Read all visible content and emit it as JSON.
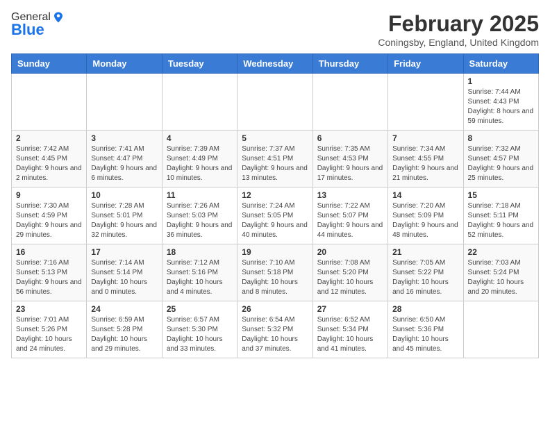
{
  "logo": {
    "general": "General",
    "blue": "Blue"
  },
  "header": {
    "month": "February 2025",
    "location": "Coningsby, England, United Kingdom"
  },
  "weekdays": [
    "Sunday",
    "Monday",
    "Tuesday",
    "Wednesday",
    "Thursday",
    "Friday",
    "Saturday"
  ],
  "weeks": [
    [
      {
        "day": "",
        "info": ""
      },
      {
        "day": "",
        "info": ""
      },
      {
        "day": "",
        "info": ""
      },
      {
        "day": "",
        "info": ""
      },
      {
        "day": "",
        "info": ""
      },
      {
        "day": "",
        "info": ""
      },
      {
        "day": "1",
        "info": "Sunrise: 7:44 AM\nSunset: 4:43 PM\nDaylight: 8 hours and 59 minutes."
      }
    ],
    [
      {
        "day": "2",
        "info": "Sunrise: 7:42 AM\nSunset: 4:45 PM\nDaylight: 9 hours and 2 minutes."
      },
      {
        "day": "3",
        "info": "Sunrise: 7:41 AM\nSunset: 4:47 PM\nDaylight: 9 hours and 6 minutes."
      },
      {
        "day": "4",
        "info": "Sunrise: 7:39 AM\nSunset: 4:49 PM\nDaylight: 9 hours and 10 minutes."
      },
      {
        "day": "5",
        "info": "Sunrise: 7:37 AM\nSunset: 4:51 PM\nDaylight: 9 hours and 13 minutes."
      },
      {
        "day": "6",
        "info": "Sunrise: 7:35 AM\nSunset: 4:53 PM\nDaylight: 9 hours and 17 minutes."
      },
      {
        "day": "7",
        "info": "Sunrise: 7:34 AM\nSunset: 4:55 PM\nDaylight: 9 hours and 21 minutes."
      },
      {
        "day": "8",
        "info": "Sunrise: 7:32 AM\nSunset: 4:57 PM\nDaylight: 9 hours and 25 minutes."
      }
    ],
    [
      {
        "day": "9",
        "info": "Sunrise: 7:30 AM\nSunset: 4:59 PM\nDaylight: 9 hours and 29 minutes."
      },
      {
        "day": "10",
        "info": "Sunrise: 7:28 AM\nSunset: 5:01 PM\nDaylight: 9 hours and 32 minutes."
      },
      {
        "day": "11",
        "info": "Sunrise: 7:26 AM\nSunset: 5:03 PM\nDaylight: 9 hours and 36 minutes."
      },
      {
        "day": "12",
        "info": "Sunrise: 7:24 AM\nSunset: 5:05 PM\nDaylight: 9 hours and 40 minutes."
      },
      {
        "day": "13",
        "info": "Sunrise: 7:22 AM\nSunset: 5:07 PM\nDaylight: 9 hours and 44 minutes."
      },
      {
        "day": "14",
        "info": "Sunrise: 7:20 AM\nSunset: 5:09 PM\nDaylight: 9 hours and 48 minutes."
      },
      {
        "day": "15",
        "info": "Sunrise: 7:18 AM\nSunset: 5:11 PM\nDaylight: 9 hours and 52 minutes."
      }
    ],
    [
      {
        "day": "16",
        "info": "Sunrise: 7:16 AM\nSunset: 5:13 PM\nDaylight: 9 hours and 56 minutes."
      },
      {
        "day": "17",
        "info": "Sunrise: 7:14 AM\nSunset: 5:14 PM\nDaylight: 10 hours and 0 minutes."
      },
      {
        "day": "18",
        "info": "Sunrise: 7:12 AM\nSunset: 5:16 PM\nDaylight: 10 hours and 4 minutes."
      },
      {
        "day": "19",
        "info": "Sunrise: 7:10 AM\nSunset: 5:18 PM\nDaylight: 10 hours and 8 minutes."
      },
      {
        "day": "20",
        "info": "Sunrise: 7:08 AM\nSunset: 5:20 PM\nDaylight: 10 hours and 12 minutes."
      },
      {
        "day": "21",
        "info": "Sunrise: 7:05 AM\nSunset: 5:22 PM\nDaylight: 10 hours and 16 minutes."
      },
      {
        "day": "22",
        "info": "Sunrise: 7:03 AM\nSunset: 5:24 PM\nDaylight: 10 hours and 20 minutes."
      }
    ],
    [
      {
        "day": "23",
        "info": "Sunrise: 7:01 AM\nSunset: 5:26 PM\nDaylight: 10 hours and 24 minutes."
      },
      {
        "day": "24",
        "info": "Sunrise: 6:59 AM\nSunset: 5:28 PM\nDaylight: 10 hours and 29 minutes."
      },
      {
        "day": "25",
        "info": "Sunrise: 6:57 AM\nSunset: 5:30 PM\nDaylight: 10 hours and 33 minutes."
      },
      {
        "day": "26",
        "info": "Sunrise: 6:54 AM\nSunset: 5:32 PM\nDaylight: 10 hours and 37 minutes."
      },
      {
        "day": "27",
        "info": "Sunrise: 6:52 AM\nSunset: 5:34 PM\nDaylight: 10 hours and 41 minutes."
      },
      {
        "day": "28",
        "info": "Sunrise: 6:50 AM\nSunset: 5:36 PM\nDaylight: 10 hours and 45 minutes."
      },
      {
        "day": "",
        "info": ""
      }
    ]
  ]
}
